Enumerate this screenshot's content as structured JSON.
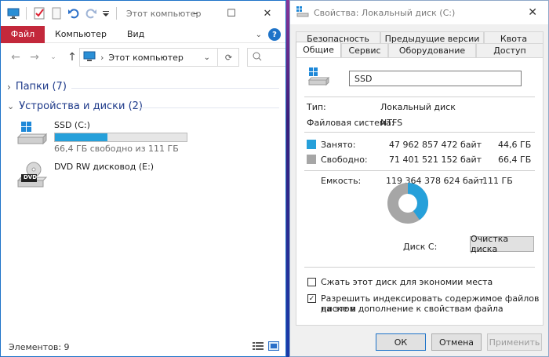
{
  "explorer": {
    "title": "Этот компьютер",
    "ribbon_tabs": [
      "Файл",
      "Компьютер",
      "Вид"
    ],
    "help_label": "?",
    "address": "Этот компьютер",
    "groups": {
      "folders": "Папки (7)",
      "devices": "Устройства и диски (2)"
    },
    "drives": [
      {
        "name": "SSD (C:)",
        "free_text": "66,4 ГБ свободно из 111 ГБ",
        "used_fraction": 0.4
      },
      {
        "name": "DVD RW дисковод (E:)",
        "icon_label": "DVD"
      }
    ],
    "status": "Элементов: 9",
    "window_controls": [
      "–",
      "☐",
      "✕"
    ]
  },
  "props": {
    "title": "Свойства: Локальный диск (C:)",
    "tabs_top": [
      "Безопасность",
      "Предыдущие версии",
      "Квота"
    ],
    "tabs_bottom": [
      "Общие",
      "Сервис",
      "Оборудование",
      "Доступ"
    ],
    "active_tab": "Общие",
    "name_value": "SSD",
    "type_label": "Тип:",
    "type_value": "Локальный диск",
    "fs_label": "Файловая система:",
    "fs_value": "NTFS",
    "used_label": "Занято:",
    "used_bytes": "47 962 857 472 байт",
    "used_gb": "44,6 ГБ",
    "free_label": "Свободно:",
    "free_bytes": "71 401 521 152 байт",
    "free_gb": "66,4 ГБ",
    "cap_label": "Емкость:",
    "cap_bytes": "119 364 378 624 байт",
    "cap_gb": "111 ГБ",
    "used_fraction": 0.4018,
    "disk_label": "Диск C:",
    "cleanup_button": "Очистка диска",
    "compress_label": "Сжать этот диск для экономии места",
    "compress_checked": false,
    "index_label_1": "Разрешить индексировать содержимое файлов на этом",
    "index_label_2": "диске в дополнение к свойствам файла",
    "index_checked": true,
    "ok": "ОК",
    "cancel": "Отмена",
    "apply": "Применить",
    "close_glyph": "✕"
  },
  "colors": {
    "used": "#26a0da",
    "free": "#a6a6a6",
    "file_tab": "#c3283b",
    "group_header": "#1e3a8a"
  }
}
